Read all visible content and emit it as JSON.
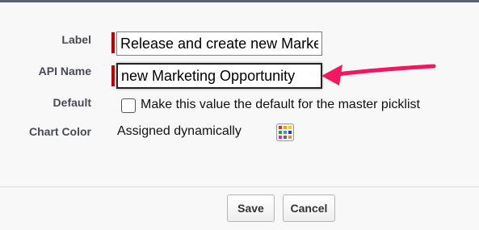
{
  "form": {
    "label": {
      "label": "Label",
      "value": "Release and create new Marketing Opportunity"
    },
    "api_name": {
      "label": "API Name",
      "value": "new Marketing Opportunity"
    },
    "default": {
      "label": "Default",
      "checkbox_text": "Make this value the default for the master picklist",
      "checked": false
    },
    "chart_color": {
      "label": "Chart Color",
      "value": "Assigned dynamically",
      "picker_icon": "color-palette-icon"
    }
  },
  "buttons": {
    "save": "Save",
    "cancel": "Cancel"
  },
  "colors": {
    "required_bar": "#c00000",
    "annotation_arrow": "#f0195f",
    "palette": [
      "#d33",
      "#f90",
      "#fc0",
      "#393",
      "#39c",
      "#33c",
      "#c3c",
      "#666",
      "#c96"
    ]
  }
}
